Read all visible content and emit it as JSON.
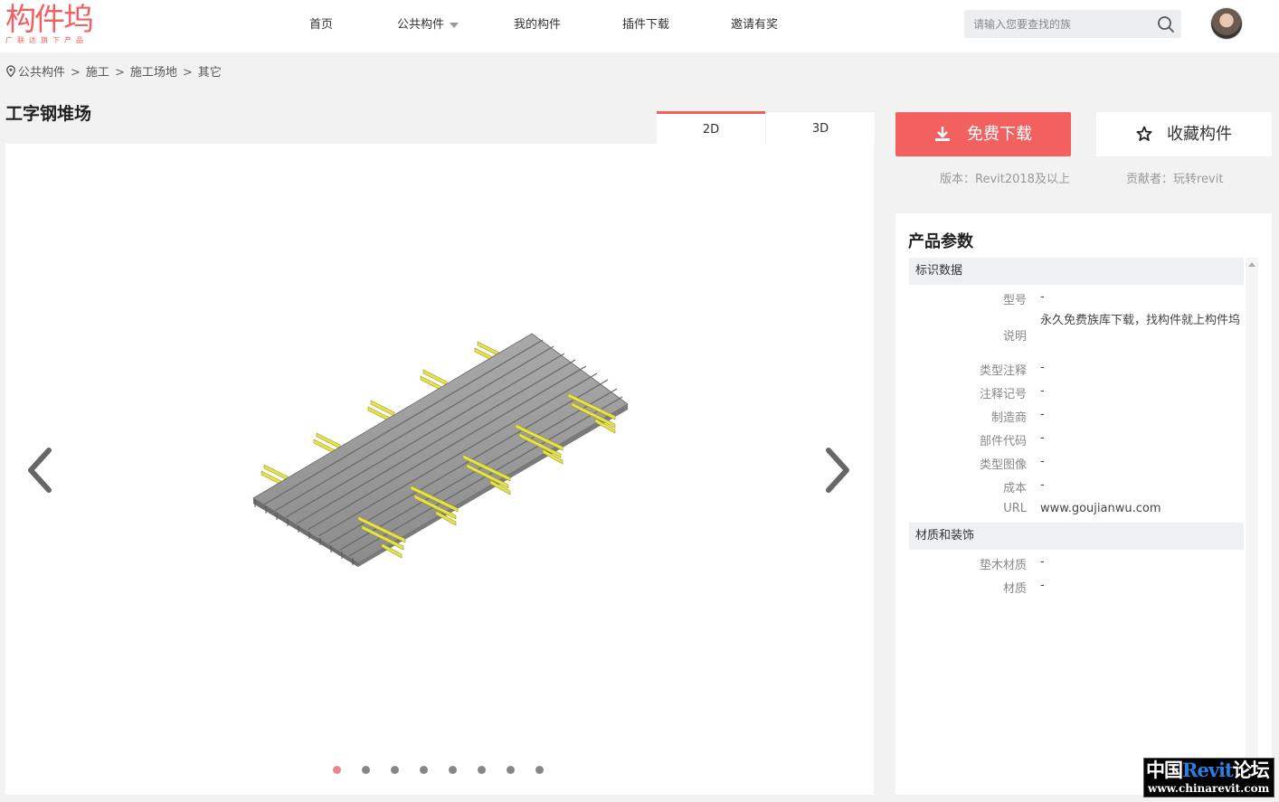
{
  "header": {
    "logo_text": "构件坞",
    "logo_slogan": "广联达旗下产品",
    "nav": [
      {
        "label": "首页"
      },
      {
        "label": "公共构件"
      },
      {
        "label": "我的构件"
      },
      {
        "label": "插件下载"
      },
      {
        "label": "邀请有奖"
      }
    ],
    "search_placeholder": "请输入您要查找的族"
  },
  "breadcrumb": [
    "公共构件",
    "施工",
    "施工场地",
    "其它"
  ],
  "page_title": "工字钢堆场",
  "viewer": {
    "tabs": [
      {
        "label": "2D"
      },
      {
        "label": "3D"
      }
    ],
    "active_tab": "2D",
    "dots_count": 8,
    "active_dot": 1
  },
  "actions": {
    "download_label": "免费下载",
    "favorite_label": "收藏构件",
    "version": "版本：Revit2018及以上",
    "contributor": "贡献者：玩转revit"
  },
  "params": {
    "title": "产品参数",
    "groups": [
      {
        "name": "标识数据",
        "rows": [
          {
            "label": "型号",
            "value": "-"
          },
          {
            "label": "说明",
            "value": "永久免费族库下载，找构件就上构件坞"
          },
          {
            "label": "类型注释",
            "value": "-"
          },
          {
            "label": "注释记号",
            "value": "-"
          },
          {
            "label": "制造商",
            "value": "-"
          },
          {
            "label": "部件代码",
            "value": "-"
          },
          {
            "label": "类型图像",
            "value": "-"
          },
          {
            "label": "成本",
            "value": "-"
          },
          {
            "label": "URL",
            "value": "www.goujianwu.com"
          }
        ]
      },
      {
        "name": "材质和装饰",
        "rows": [
          {
            "label": "垫木材质",
            "value": "-"
          },
          {
            "label": "材质",
            "value": "-"
          }
        ]
      }
    ]
  },
  "watermark": {
    "line1_a": "中国",
    "line1_b": "Revit",
    "line1_c": "论坛",
    "line2": "www.chinarevit.com"
  },
  "colors": {
    "accent": "#f26060",
    "beam": "#9a9a9a",
    "timber": "#e6e34a"
  }
}
